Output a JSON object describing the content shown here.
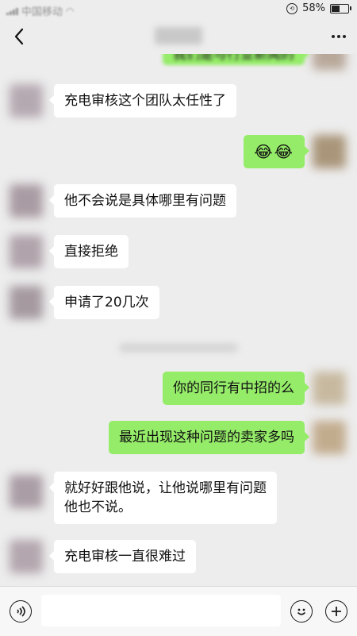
{
  "status_bar": {
    "carrier": "中国移动",
    "time": "",
    "battery": "58%",
    "battery_level": 0.58
  },
  "nav": {
    "title": ""
  },
  "messages": [
    {
      "dir": "out",
      "text": "我们是与行业新闻的"
    },
    {
      "dir": "in",
      "text": "充电审核这个团队太任性了"
    },
    {
      "dir": "out",
      "text": "😂😂"
    },
    {
      "dir": "in",
      "text": "他不会说是具体哪里有问题"
    },
    {
      "dir": "in",
      "text": "直接拒绝"
    },
    {
      "dir": "in",
      "text": "申请了20几次"
    },
    {
      "dir": "out",
      "text": "你的同行有中招的么"
    },
    {
      "dir": "out",
      "text": "最近出现这种问题的卖家多吗"
    },
    {
      "dir": "in",
      "text": "就好好跟他说，让他说哪里有问题",
      "text2": "他也不说。"
    },
    {
      "dir": "in",
      "text": "充电审核一直很难过"
    }
  ],
  "input": {
    "placeholder": ""
  },
  "icons": {
    "back": "chevron-left-icon",
    "more": "more-dots-icon",
    "voice": "voice-icon",
    "emoji": "emoji-icon",
    "plus": "plus-icon"
  }
}
